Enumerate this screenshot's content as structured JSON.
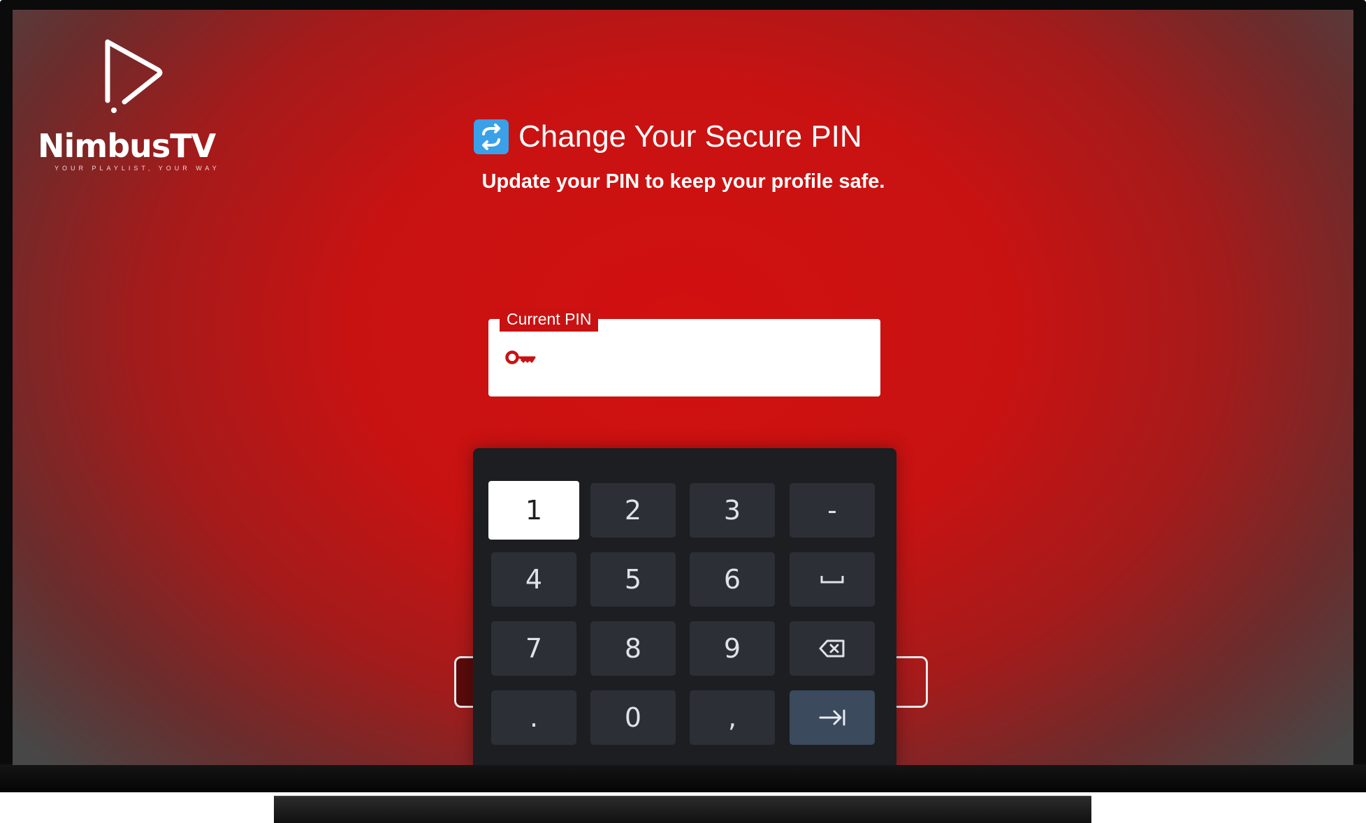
{
  "app": {
    "name": "NimbusTV",
    "tagline": "YOUR PLAYLIST, YOUR WAY",
    "logo_icon": "play-triangle-icon",
    "accent_color": "#c81212"
  },
  "header": {
    "title_icon": "arrows-counterclockwise-icon",
    "title": "Change Your Secure PIN",
    "subtitle": "Update your PIN to keep your profile safe."
  },
  "pin_field": {
    "label": "Current PIN",
    "value": "",
    "icon": "key-icon"
  },
  "keyboard": {
    "focused_key": "1",
    "rows": [
      [
        "1",
        "2",
        "3",
        "-"
      ],
      [
        "4",
        "5",
        "6",
        "space"
      ],
      [
        "7",
        "8",
        "9",
        "backspace"
      ],
      [
        ".",
        "0",
        ",",
        "next"
      ]
    ],
    "labels": {
      "k1": "1",
      "k2": "2",
      "k3": "3",
      "dash": "-",
      "k4": "4",
      "k5": "5",
      "k6": "6",
      "k7": "7",
      "k8": "8",
      "k9": "9",
      "dot": ".",
      "k0": "0",
      "comma": ","
    }
  }
}
